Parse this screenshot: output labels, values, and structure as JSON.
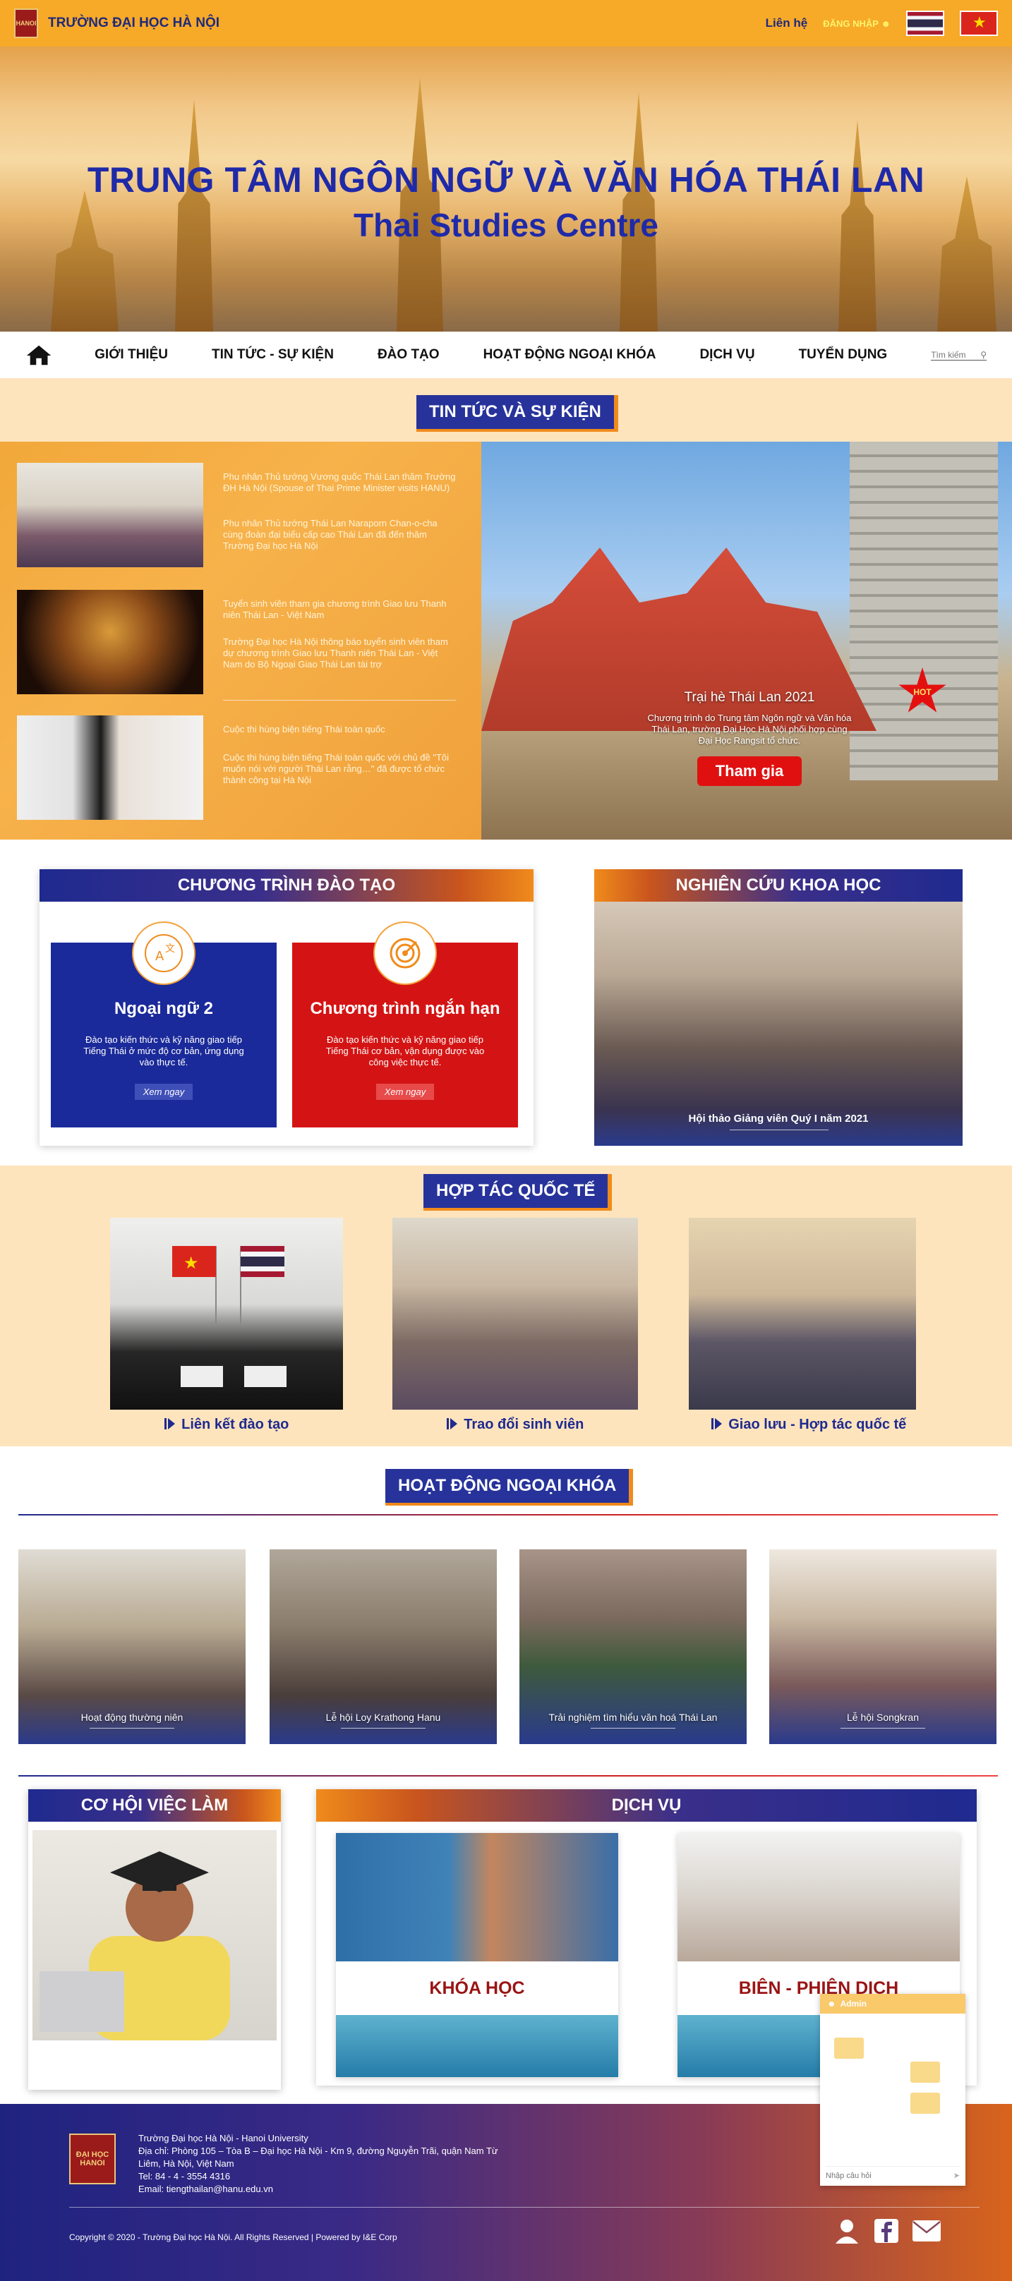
{
  "header": {
    "university": "TRƯỜNG ĐẠI HỌC HÀ NỘI",
    "contact": "Liên hệ",
    "login": "ĐĂNG NHẬP",
    "logo_text": "HANOI"
  },
  "banner": {
    "title": "TRUNG TÂM NGÔN NGỮ  VÀ VĂN HÓA THÁI LAN",
    "subtitle": "Thai Studies Centre"
  },
  "nav": {
    "items": [
      "GIỚI THIỆU",
      "TIN TỨC - SỰ KIỆN",
      "ĐÀO TẠO",
      "HOẠT ĐỘNG NGOẠI KHÓA",
      "DỊCH VỤ",
      "TUYỂN DỤNG"
    ],
    "search_placeholder": "Tìm kiếm"
  },
  "news": {
    "section_title": "TIN TỨC  VÀ SỰ KIỆN",
    "items": [
      {
        "title": "Phu nhân Thủ tướng Vương quốc Thái Lan thăm Trường ĐH Hà Nội (Spouse of Thai Prime Minister visits HANU)",
        "desc": "Phu nhân Thủ tướng Thái Lan Naraporn Chan-o-cha cùng đoàn đại biểu cấp cao Thái Lan đã đến thăm Trường Đại học Hà Nội"
      },
      {
        "title": "Tuyển sinh viên tham gia chương trình Giao lưu Thanh niên Thái Lan - Việt Nam",
        "desc": "Trường Đại học Hà Nội thông báo tuyển sinh viên tham dự chương trình Giao lưu Thanh niên Thái Lan - Việt Nam do Bộ Ngoại Giao Thái Lan tài trợ"
      },
      {
        "title": "Cuộc thi hùng biện tiếng Thái toàn quốc",
        "desc": "Cuộc thi hùng biện tiếng Thái toàn quốc với chủ đề \"Tôi muốn nói với người Thái Lan rằng…\" đã được tổ chức thành công tại Hà Nội"
      }
    ],
    "feature": {
      "title": "Trại hè Thái Lan 2021",
      "desc": "Chương trình do Trung tâm Ngôn ngữ và Văn hóa Thái Lan, trường Đại Học Hà Nội phối hợp cùng Đại Học Rangsit tổ chức.",
      "button": "Tham gia",
      "badge": "HOT"
    }
  },
  "programs": {
    "title": "CHƯƠNG TRÌNH ĐÀO TẠO",
    "cards": [
      {
        "title": "Ngoại ngữ 2",
        "desc": "Đào tạo kiến thức và kỹ năng giao tiếp Tiếng Thái ở mức độ cơ bản, ứng dụng vào thực tế.",
        "button": "Xem ngay",
        "color": "#1b2a9a"
      },
      {
        "title": "Chương trình ngắn hạn",
        "desc": "Đào tạo kiến thức và kỹ năng giao tiếp Tiếng Thái cơ bản, vận dụng được vào công việc thực tế.",
        "button": "Xem ngay",
        "color": "#d41414"
      }
    ]
  },
  "research": {
    "title": "NGHIÊN CỨU KHOA HỌC",
    "caption": "Hội thảo Giảng viên Quý I năm 2021"
  },
  "cooperation": {
    "title": "HỢP TÁC QUỐC TẾ",
    "items": [
      "Liên kết đào tạo",
      "Trao đổi sinh viên",
      "Giao lưu - Hợp tác quốc tế"
    ]
  },
  "extracurricular": {
    "title": "HOẠT ĐỘNG NGOẠI KHÓA",
    "items": [
      "Hoạt động thường niên",
      "Lễ hội Loy Krathong Hanu",
      "Trải nghiệm tìm hiểu văn hoá Thái Lan",
      "Lễ hội Songkran"
    ]
  },
  "jobs": {
    "title": "CƠ HỘI VIỆC LÀM"
  },
  "services": {
    "title": "DỊCH VỤ",
    "items": [
      "KHÓA HỌC",
      "BIÊN - PHIÊN DỊCH"
    ]
  },
  "footer": {
    "logo_top": "ĐẠI HỌC",
    "logo_bottom": "HANOI",
    "lines": [
      "Trường Đại học Hà Nội - Hanoi University",
      "Địa chỉ: Phòng 105 – Tòa B – Đại học Hà Nội - Km 9, đường  Nguyễn Trãi, quận Nam Từ Liêm, Hà Nội, Việt Nam",
      "Tel: 84 - 4 - 3554 4316",
      "Email: tiengthailan@hanu.edu.vn"
    ],
    "copyright": "Copyright © 2020 - Trường Đại học Hà Nội. All Rights Reserved | Powered by I&E Corp"
  },
  "chat": {
    "agent": "Admin",
    "placeholder": "Nhập câu hỏi"
  }
}
